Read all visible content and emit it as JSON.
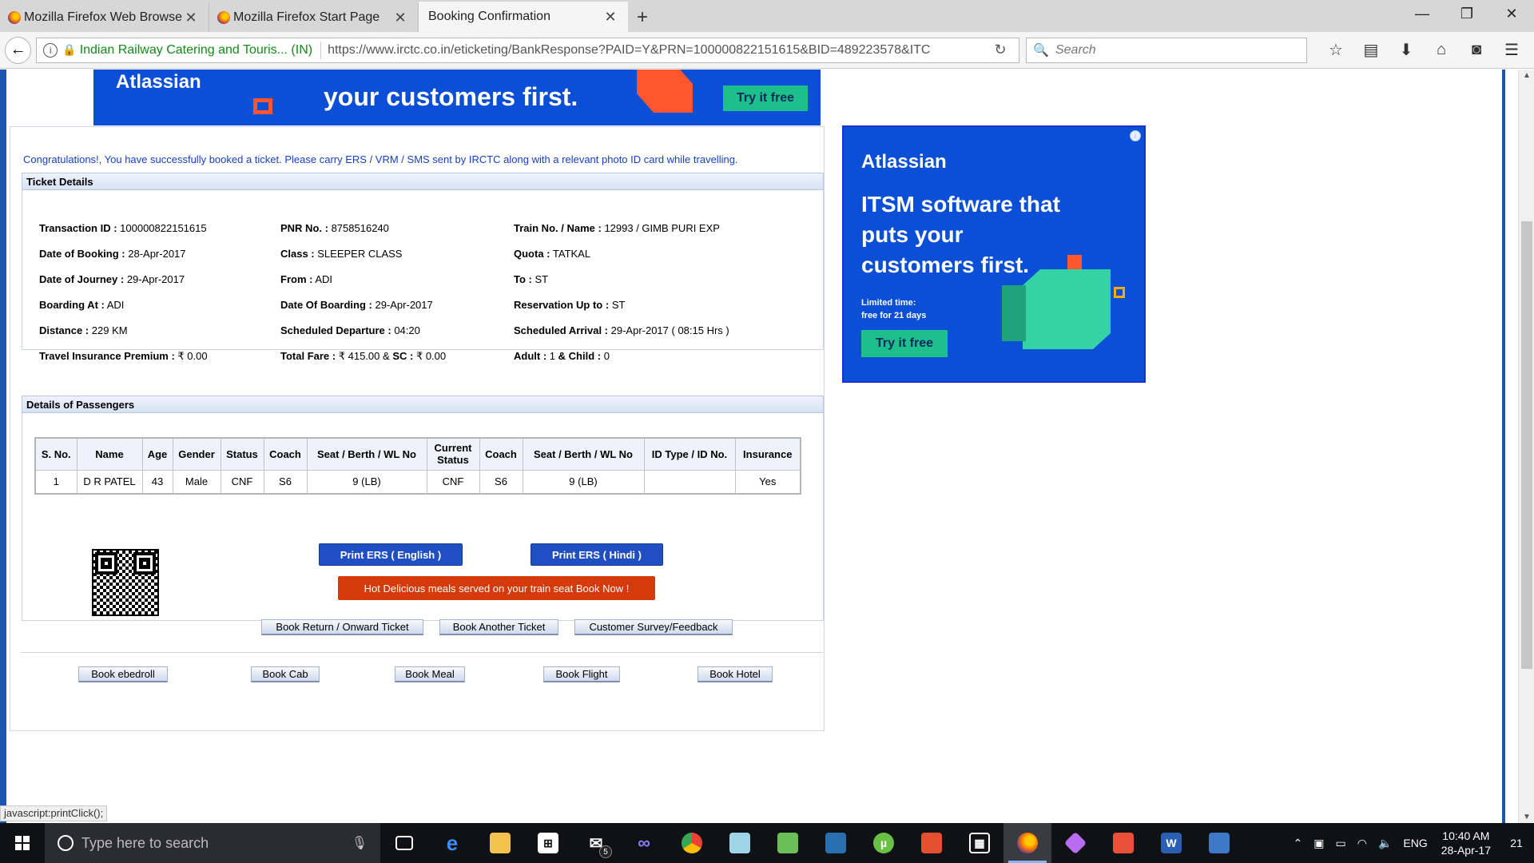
{
  "browser": {
    "tabs": [
      {
        "title": "Mozilla Firefox Web Browser",
        "active": false
      },
      {
        "title": "Mozilla Firefox Start Page",
        "active": false
      },
      {
        "title": "Booking Confirmation",
        "active": true
      }
    ],
    "new_tab_label": "+",
    "identity": "Indian Railway Catering and Touris... (IN)",
    "url": "https://www.irctc.co.in/eticketing/BankResponse?PAID=Y&PRN=100000822151615&BID=489223578&ITC",
    "search_placeholder": "Search"
  },
  "ads": {
    "top": {
      "brand": "Atlassian",
      "line": "your customers first.",
      "cta": "Try it free"
    },
    "side": {
      "brand": "Atlassian",
      "headline": "ITSM software that puts your customers first.",
      "limited_line1": "Limited time:",
      "limited_line2": "free for 21 days",
      "cta": "Try it free",
      "info": "i"
    }
  },
  "page": {
    "congrats": "Congratulations!, You have successfully booked a ticket. Please carry ERS / VRM / SMS sent by IRCTC along with a relevant photo ID card while travelling.",
    "ticket_section_title": "Ticket Details",
    "ticket": {
      "transaction_id": {
        "label": "Transaction ID :",
        "value": "100000822151615"
      },
      "pnr": {
        "label": "PNR No. :",
        "value": "8758516240"
      },
      "train": {
        "label": "Train No. / Name :",
        "value": "12993 / GIMB PURI EXP"
      },
      "date_of_booking": {
        "label": "Date of Booking :",
        "value": "28-Apr-2017"
      },
      "class": {
        "label": "Class :",
        "value": "SLEEPER CLASS"
      },
      "quota": {
        "label": "Quota :",
        "value": "TATKAL"
      },
      "date_of_journey": {
        "label": "Date of Journey :",
        "value": "29-Apr-2017"
      },
      "from": {
        "label": "From :",
        "value": "ADI"
      },
      "to": {
        "label": "To :",
        "value": "ST"
      },
      "boarding_at": {
        "label": "Boarding At :",
        "value": "ADI"
      },
      "date_of_boarding": {
        "label": "Date Of Boarding :",
        "value": "29-Apr-2017"
      },
      "reservation_up_to": {
        "label": "Reservation Up to :",
        "value": "ST"
      },
      "distance": {
        "label": "Distance :",
        "value": "229 KM"
      },
      "scheduled_departure": {
        "label": "Scheduled Departure :",
        "value": "04:20"
      },
      "scheduled_arrival": {
        "label": "Scheduled Arrival :",
        "value": "29-Apr-2017 ( 08:15 Hrs )"
      },
      "insurance_premium": {
        "label": "Travel Insurance Premium :",
        "value": "₹ 0.00"
      },
      "total_fare": {
        "label": "Total Fare :",
        "value": "₹ 415.00",
        "sc_label": "SC :",
        "sc_value": "₹ 0.00",
        "amp": "&"
      },
      "passengers_count": {
        "adult_label": "Adult :",
        "adult_value": "1",
        "amp": "&",
        "child_label": "Child :",
        "child_value": "0"
      }
    },
    "passengers_section_title": "Details of Passengers",
    "passenger_table": {
      "headers": [
        "S. No.",
        "Name",
        "Age",
        "Gender",
        "Status",
        "Coach",
        "Seat / Berth / WL No",
        "Current Status",
        "Coach",
        "Seat / Berth / WL No",
        "ID Type / ID No.",
        "Insurance"
      ],
      "rows": [
        [
          "1",
          "D R PATEL",
          "43",
          "Male",
          "CNF",
          "S6",
          "9 (LB)",
          "CNF",
          "S6",
          "9 (LB)",
          "",
          "Yes"
        ]
      ]
    },
    "buttons": {
      "print_english": "Print ERS ( English )",
      "print_hindi": "Print ERS ( Hindi )",
      "meals": "Hot Delicious meals served on your train seat Book Now !",
      "book_return": "Book Return / Onward Ticket",
      "book_another": "Book Another Ticket",
      "survey": "Customer Survey/Feedback",
      "book_ebedroll": "Book ebedroll",
      "book_cab": "Book Cab",
      "book_meal": "Book Meal",
      "book_flight": "Book Flight",
      "book_hotel": "Book Hotel"
    },
    "status_text": "javascript:printClick();"
  },
  "taskbar": {
    "search_placeholder": "Type here to search",
    "mail_badge": "5",
    "language": "ENG",
    "time": "10:40 AM",
    "date": "28-Apr-17",
    "notifications": "21"
  },
  "colors": {
    "accent_blue": "#1f4fc2",
    "congrats_text": "#1740c8",
    "meals_red": "#d43a0a",
    "ad_blue": "#0b4fd6",
    "ad_green": "#1dbf8a"
  }
}
